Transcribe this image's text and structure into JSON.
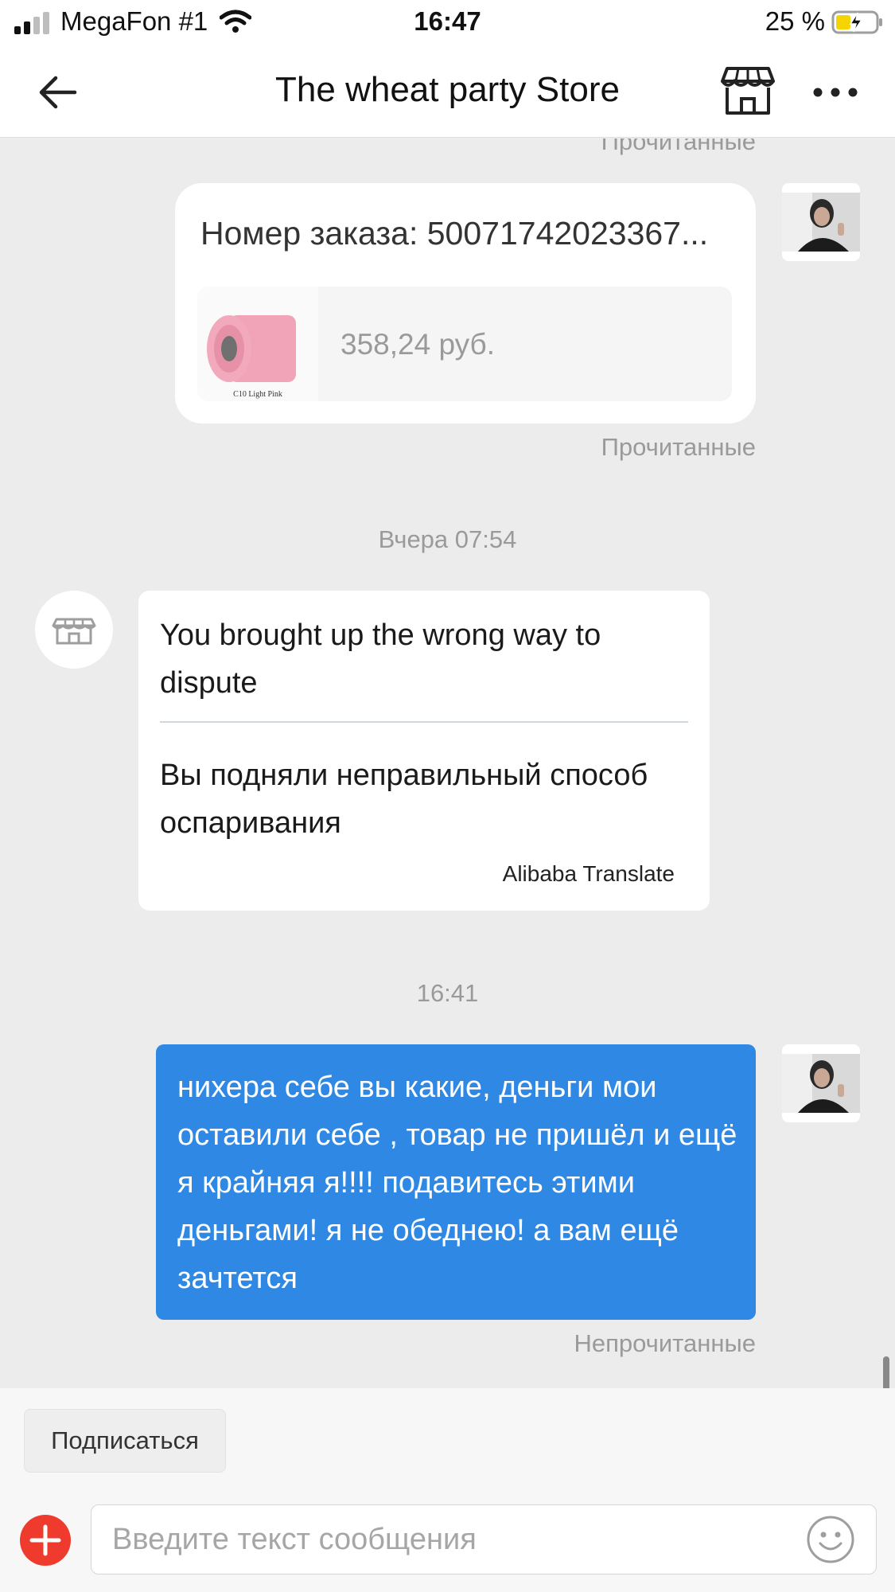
{
  "status_bar": {
    "carrier": "MegaFon #1",
    "time": "16:47",
    "battery": "25 %"
  },
  "header": {
    "title": "The wheat party Store",
    "icons": [
      "back-arrow-icon",
      "store-icon",
      "more-icon"
    ]
  },
  "chat": {
    "top_read_status": "Прочитанные",
    "order_card": {
      "order_number": "Номер заказа: 50071742023367...",
      "thumb_label": "C10 Light Pink",
      "price": "358,24 руб.",
      "read_status": "Прочитанные"
    },
    "timestamp_1": "Вчера 07:54",
    "store_message": {
      "original": "You brought up the wrong way to dispute",
      "translated": "Вы подняли неправильный способ оспаривания",
      "translate_credit": "Alibaba Translate"
    },
    "timestamp_2": "16:41",
    "user_message": {
      "text": "нихера себе вы какие, деньги мои оставили себе , товар не пришёл и ещё я крайняя я!!!! подавитесь этими деньгами! я не обеднею! а вам ещё зачтется",
      "read_status": "Непрочитанные"
    }
  },
  "bottom_bar": {
    "subscribe_label": "Подписаться",
    "input_placeholder": "Введите текст сообщения"
  },
  "colors": {
    "accent_blue": "#2f88e3",
    "add_button_red": "#ee3b2e",
    "battery_yellow": "#f5d400"
  }
}
